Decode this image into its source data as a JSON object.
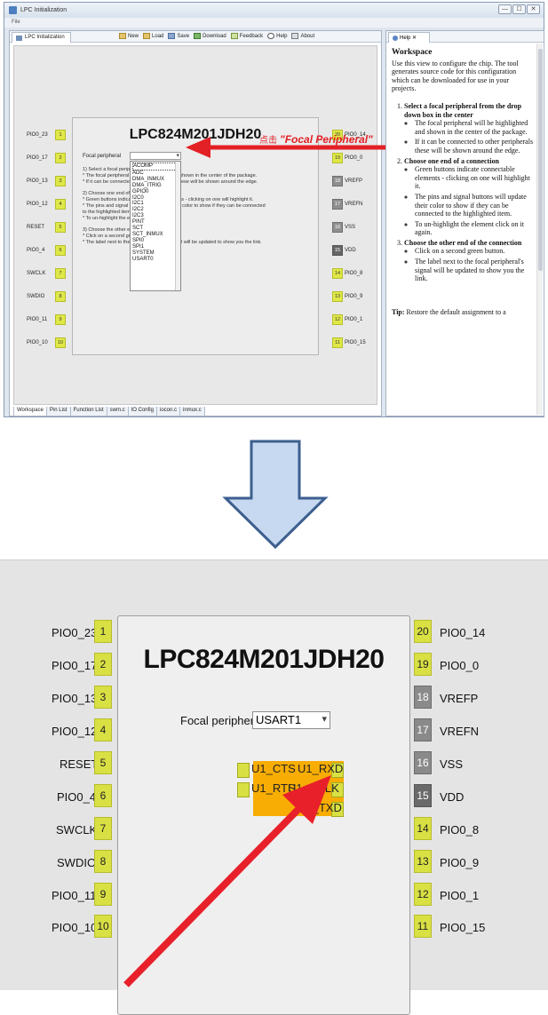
{
  "window": {
    "title": "LPC Initialization",
    "menu": "File",
    "buttons": [
      "—",
      "☐",
      "✕"
    ]
  },
  "view_tab": "LPC Initialization",
  "toolbar": [
    "New",
    "Load",
    "Save",
    "Download",
    "Feedback",
    "Help",
    "About"
  ],
  "chip_name": "LPC824M201JDH20",
  "focal": {
    "label": "Focal peripheral",
    "zoom_label": "Focal peripheral:",
    "selected": "USART1"
  },
  "instructions": [
    "1) Select a focal peripheral",
    "* The focal peripheral will be highlighted and shown in the center of the package.",
    "* If it can be connected to other peripherals these will be shown around the edge.",
    "",
    "2) Choose one end of a connection",
    "* Green buttons indicate connectable elements - clicking on one will highlight it.",
    "* The pins and signal buttons will update their color to show if they can be connected",
    "to the highlighted item.",
    "* To un-highlight the element click on it again.",
    "",
    "3) Choose the other end of the connection",
    "* Click on a second green button.",
    "* The label next to the focal peripheral's signal will be updated to show you the link."
  ],
  "dropdown_options": [
    "ACOMP",
    "ADC",
    "DMA_INMUX",
    "DMA_ITRIG",
    "GPIO0",
    "I2C0",
    "I2C1",
    "I2C2",
    "I2C3",
    "PINT",
    "SCT",
    "SCT_INMUX",
    "SPI0",
    "SPI1",
    "SYSTEM",
    "USART0"
  ],
  "annotation": {
    "cn": "点击",
    "en": "\"Focal Peripheral\""
  },
  "left_pins": [
    {
      "num": "1",
      "label": "PIO0_23"
    },
    {
      "num": "2",
      "label": "PIO0_17"
    },
    {
      "num": "3",
      "label": "PIO0_13"
    },
    {
      "num": "4",
      "label": "PIO0_12"
    },
    {
      "num": "5",
      "label": "RESET"
    },
    {
      "num": "6",
      "label": "PIO0_4"
    },
    {
      "num": "7",
      "label": "SWCLK"
    },
    {
      "num": "8",
      "label": "SWDIO"
    },
    {
      "num": "9",
      "label": "PIO0_11"
    },
    {
      "num": "10",
      "label": "PIO0_10"
    }
  ],
  "right_pins": [
    {
      "num": "20",
      "label": "PIO0_14",
      "state": "green"
    },
    {
      "num": "19",
      "label": "PIO0_0",
      "state": "green"
    },
    {
      "num": "18",
      "label": "VREFP",
      "state": "gray"
    },
    {
      "num": "17",
      "label": "VREFN",
      "state": "gray"
    },
    {
      "num": "16",
      "label": "VSS",
      "state": "gray"
    },
    {
      "num": "15",
      "label": "VDD",
      "state": "dark"
    },
    {
      "num": "14",
      "label": "PIO0_8",
      "state": "green"
    },
    {
      "num": "13",
      "label": "PIO0_9",
      "state": "green"
    },
    {
      "num": "12",
      "label": "PIO0_1",
      "state": "green"
    },
    {
      "num": "11",
      "label": "PIO0_15",
      "state": "green"
    }
  ],
  "signals": {
    "left": [
      "U1_CTS",
      "U1_RTS"
    ],
    "right": [
      "U1_RXD",
      "U1_SCLK",
      "U1_TXD"
    ]
  },
  "bottom_tabs": [
    "Workspace",
    "Pin List",
    "Function List",
    "swm.c",
    "IO Config",
    "iocon.c",
    "inmux.c"
  ],
  "help": {
    "tab": "Help",
    "title": "Workspace",
    "intro": "Use this view to configure the chip. The tool generates source code for this configuration which can be downloaded for use in your projects.",
    "steps": [
      {
        "head": "Select a focal peripheral from the drop down box in the center",
        "items": [
          "The focal peripheral will be highlighted and shown in the center of the package.",
          "If it can be connected to other peripherals these will be shown around the edge."
        ]
      },
      {
        "head": "Choose one end of a connection",
        "items": [
          "Green buttons indicate connectable elements - clicking on one will highlight it.",
          "The pins and signal buttons will update their color to show if they can be connected to the highlighted item.",
          "To un-highlight the element click on it again."
        ]
      },
      {
        "head": "Choose the other end of the connection",
        "items": [
          "Click on a second green button.",
          "The label next to the focal peripheral's signal will be updated to show you the link."
        ]
      }
    ],
    "tip_label": "Tip:",
    "tip": "Restore the default assignment to a"
  }
}
